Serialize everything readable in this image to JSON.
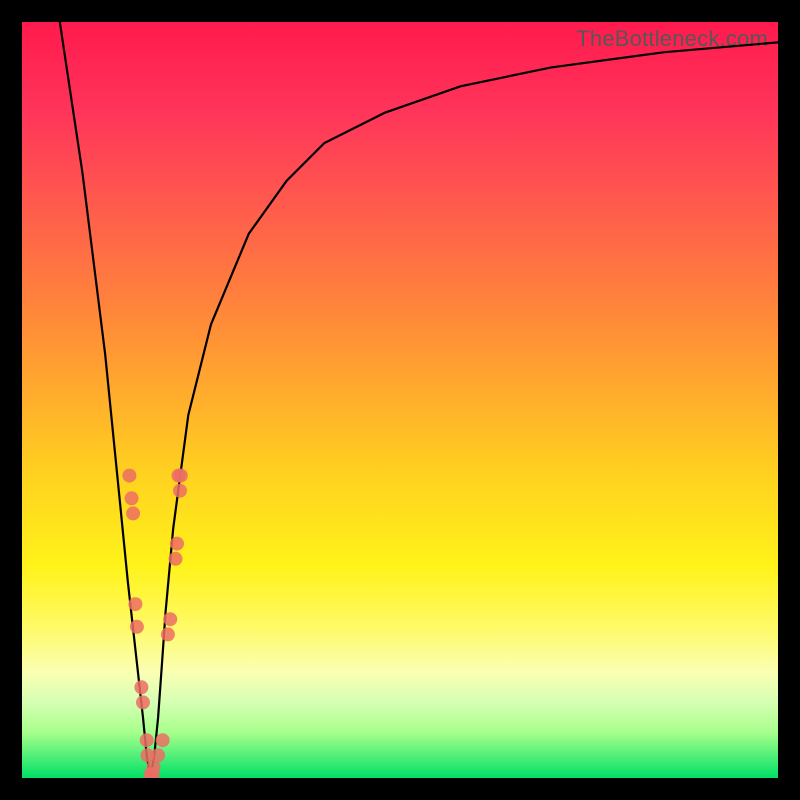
{
  "watermark": "TheBottleneck.com",
  "chart_data": {
    "type": "line",
    "title": "",
    "xlabel": "",
    "ylabel": "",
    "xlim": [
      0,
      100
    ],
    "ylim": [
      0,
      100
    ],
    "x_optimum": 17,
    "series": [
      {
        "name": "bottleneck-curve",
        "x": [
          5,
          8,
          11,
          13,
          14,
          15,
          16,
          16.5,
          17,
          17.5,
          18,
          18.5,
          19,
          20,
          22,
          25,
          30,
          35,
          40,
          48,
          58,
          70,
          85,
          100
        ],
        "y": [
          100,
          80,
          56,
          36,
          26,
          17,
          8,
          3,
          0,
          3,
          8,
          15,
          22,
          33,
          48,
          60,
          72,
          79,
          84,
          88,
          91.5,
          94,
          96,
          97.3
        ]
      }
    ],
    "markers": {
      "name": "data-points",
      "points": [
        {
          "x": 14.2,
          "y": 40
        },
        {
          "x": 14.5,
          "y": 37
        },
        {
          "x": 14.7,
          "y": 35
        },
        {
          "x": 15.0,
          "y": 23
        },
        {
          "x": 15.2,
          "y": 20
        },
        {
          "x": 15.8,
          "y": 12
        },
        {
          "x": 16.0,
          "y": 10
        },
        {
          "x": 16.5,
          "y": 5
        },
        {
          "x": 16.6,
          "y": 3
        },
        {
          "x": 17.0,
          "y": 0.5
        },
        {
          "x": 17.3,
          "y": 0.5
        },
        {
          "x": 17.4,
          "y": 1.5
        },
        {
          "x": 18.0,
          "y": 3
        },
        {
          "x": 18.6,
          "y": 5
        },
        {
          "x": 19.3,
          "y": 19
        },
        {
          "x": 19.6,
          "y": 21
        },
        {
          "x": 20.3,
          "y": 29
        },
        {
          "x": 20.5,
          "y": 31
        },
        {
          "x": 20.7,
          "y": 40
        },
        {
          "x": 20.9,
          "y": 38
        },
        {
          "x": 21.0,
          "y": 40
        }
      ]
    }
  }
}
